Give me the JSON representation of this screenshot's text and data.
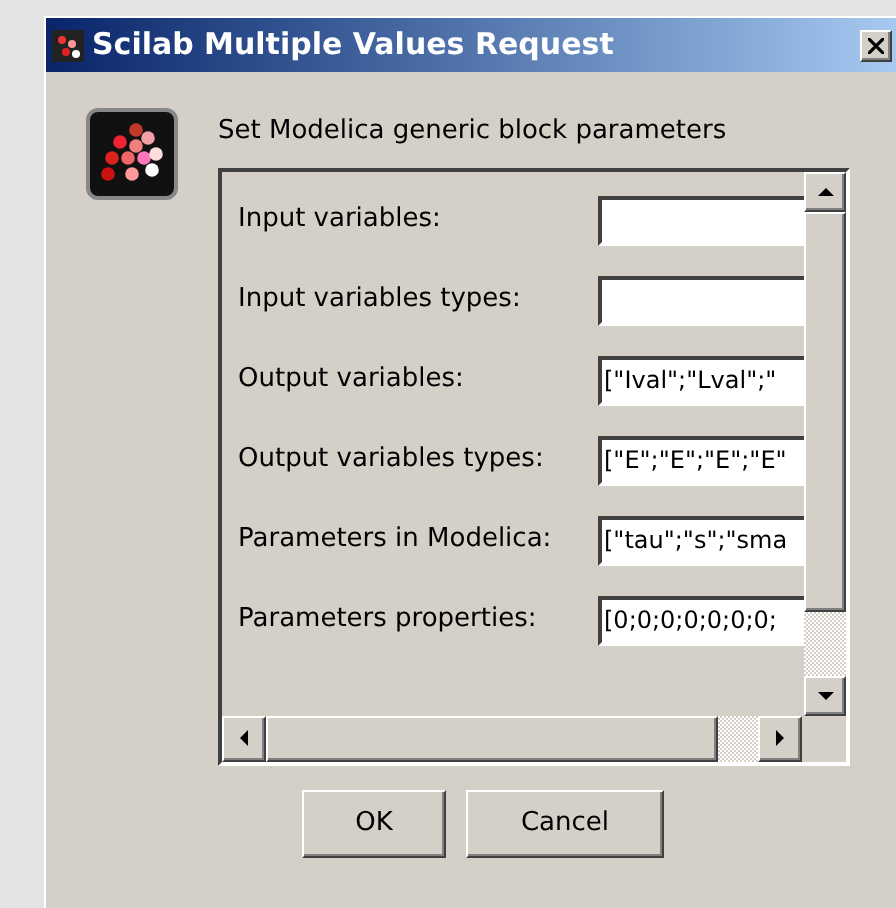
{
  "window": {
    "title": "Scilab Multiple Values Request"
  },
  "message": "Set Modelica generic block parameters",
  "fields": [
    {
      "label": "Input variables:"
    },
    {
      "label": "Input variables types:"
    },
    {
      "label": "Output variables:",
      "value": "[\"Ival\";\"Lval\";\""
    },
    {
      "label": "Output variables types:",
      "value": "[\"E\";\"E\";\"E\";\"E\""
    },
    {
      "label": "Parameters in Modelica:",
      "value": "[\"tau\";\"s\";\"sma"
    },
    {
      "label": "Parameters properties:",
      "value": "[0;0;0;0;0;0;0;"
    }
  ],
  "buttons": [
    "OK",
    "Cancel"
  ]
}
